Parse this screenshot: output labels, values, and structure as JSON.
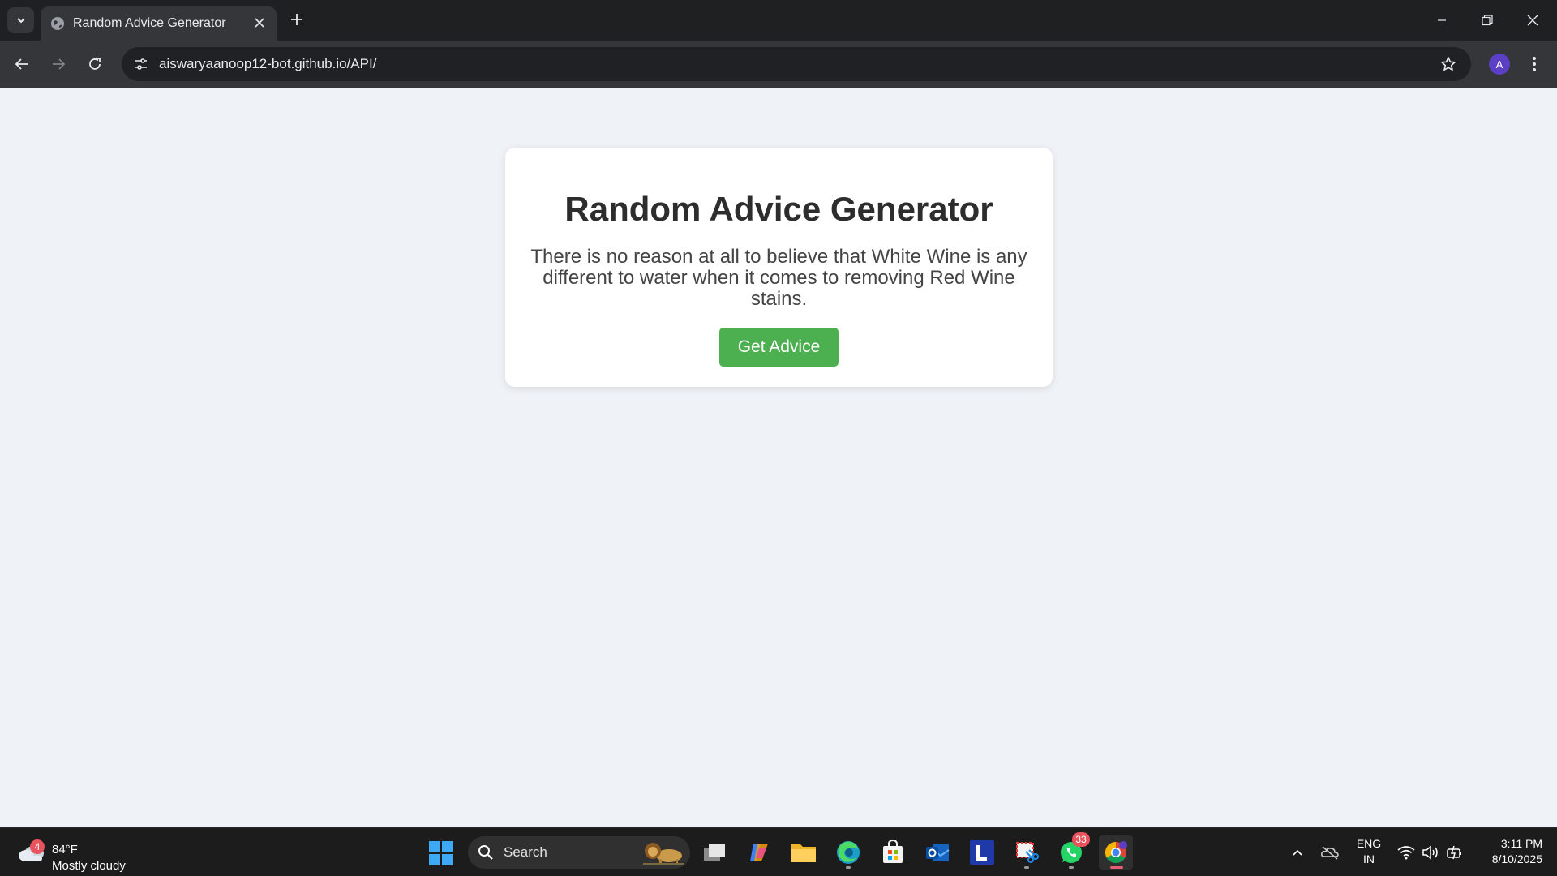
{
  "browser": {
    "tab_title": "Random Advice Generator",
    "url": "aiswaryaanoop12-bot.github.io/API/",
    "profile_initial": "A"
  },
  "page": {
    "heading": "Random Advice Generator",
    "advice": "There is no reason at all to believe that White Wine is any different to water when it comes to removing Red Wine stains.",
    "button_label": "Get Advice",
    "button_color": "#4caf50"
  },
  "taskbar": {
    "weather": {
      "badge": "4",
      "temp": "84°F",
      "desc": "Mostly cloudy"
    },
    "search_placeholder": "Search",
    "apps": [
      "task-view",
      "copilot",
      "file-explorer",
      "edge",
      "microsoft-store",
      "outlook",
      "l-app",
      "snipping-tool",
      "whatsapp",
      "chrome"
    ],
    "whatsapp_badge": "33",
    "language": {
      "line1": "ENG",
      "line2": "IN"
    },
    "clock": {
      "time": "3:11 PM",
      "date": "8/10/2025"
    }
  }
}
